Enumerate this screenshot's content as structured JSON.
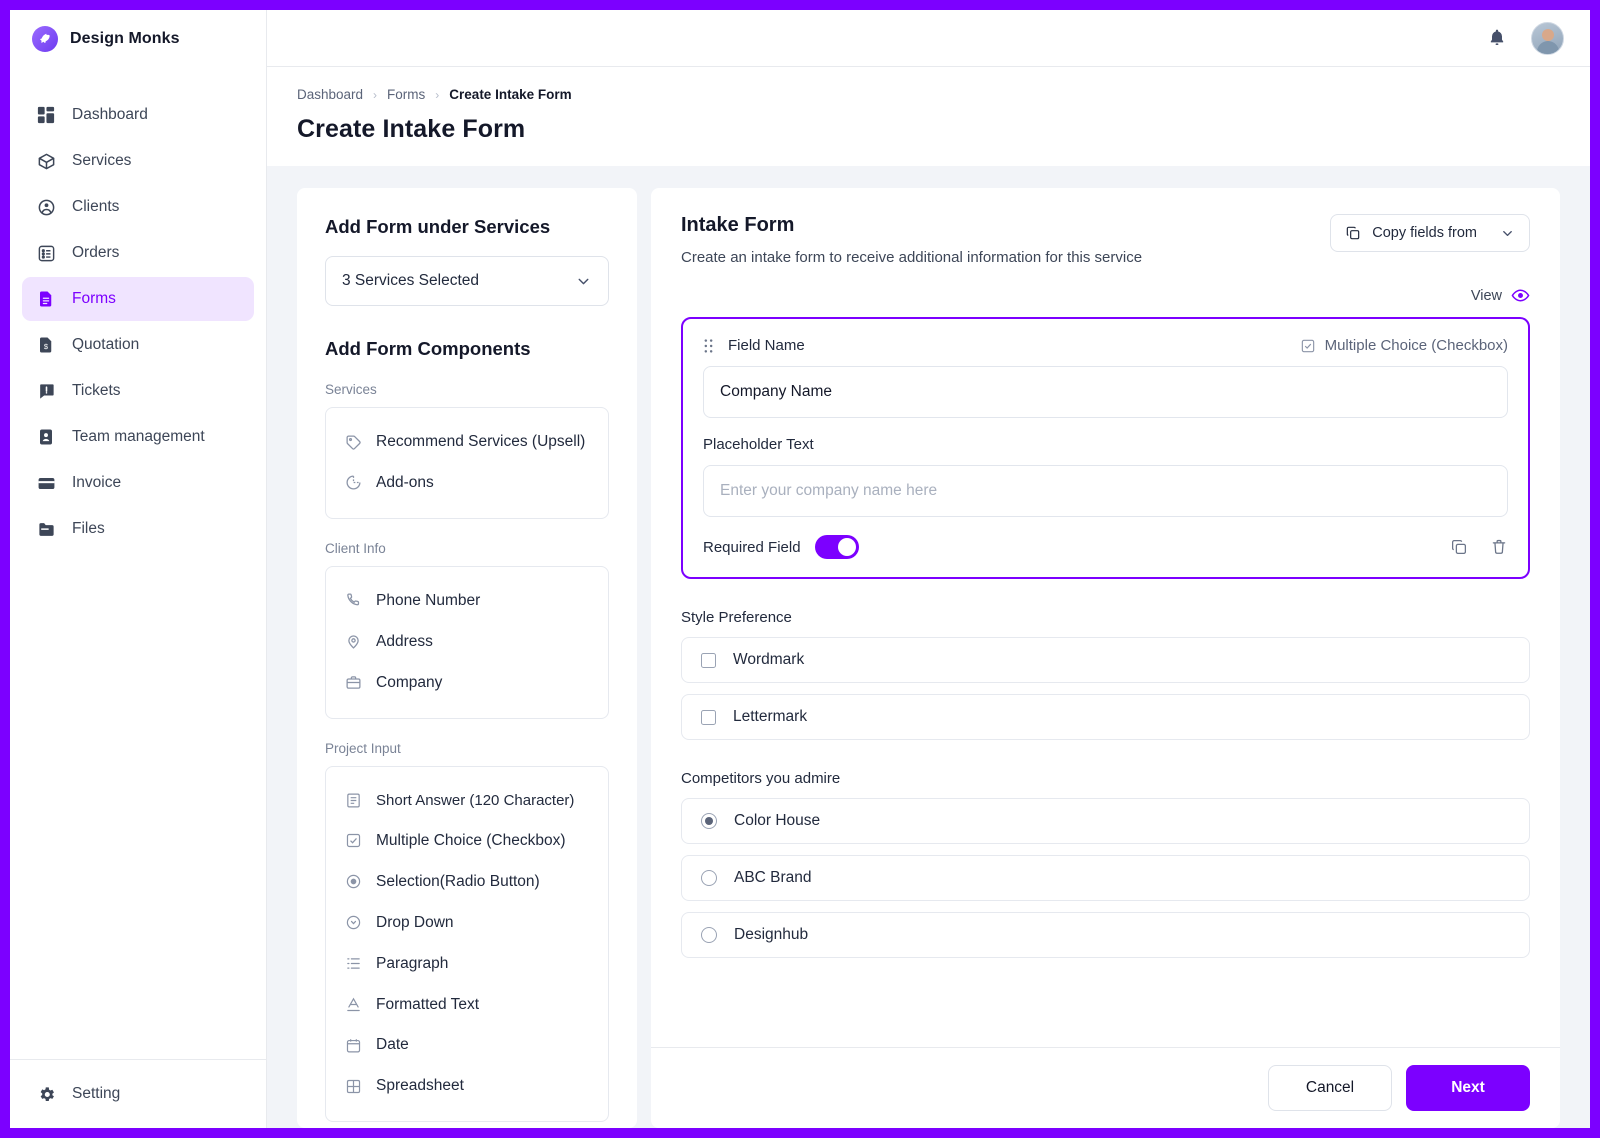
{
  "brand": {
    "name": "Design Monks",
    "logo_icon": "rocket-logo-icon",
    "accent": "#7C00FF"
  },
  "topbar": {
    "bell_icon": "notification-bell-icon",
    "avatar_icon": "user-avatar"
  },
  "sidebar": {
    "items": [
      {
        "label": "Dashboard",
        "icon": "dashboard-grid-icon",
        "active": false
      },
      {
        "label": "Services",
        "icon": "box-icon",
        "active": false
      },
      {
        "label": "Clients",
        "icon": "clients-circle-icon",
        "active": false
      },
      {
        "label": "Orders",
        "icon": "list-icon",
        "active": false
      },
      {
        "label": "Forms",
        "icon": "document-icon",
        "active": true
      },
      {
        "label": "Quotation",
        "icon": "quote-document-icon",
        "active": false
      },
      {
        "label": "Tickets",
        "icon": "ticket-alert-icon",
        "active": false
      },
      {
        "label": "Team management",
        "icon": "user-card-icon",
        "active": false
      },
      {
        "label": "Invoice",
        "icon": "invoice-card-icon",
        "active": false
      },
      {
        "label": "Files",
        "icon": "folder-icon",
        "active": false
      }
    ],
    "bottom": {
      "label": "Setting",
      "icon": "gear-icon"
    }
  },
  "breadcrumb": {
    "items": [
      "Dashboard",
      "Forms",
      "Create Intake Form"
    ],
    "separator": "›"
  },
  "page": {
    "title": "Create Intake Form"
  },
  "left_panel": {
    "heading": "Add Form under Services",
    "service_select": {
      "value": "3 Services Selected",
      "chevron_icon": "chevron-down-icon"
    },
    "components_heading": "Add Form Components",
    "groups": [
      {
        "label": "Services",
        "items": [
          {
            "label": "Recommend Services (Upsell)",
            "icon": "tag-icon"
          },
          {
            "label": "Add-ons",
            "icon": "pie-chart-icon"
          }
        ]
      },
      {
        "label": "Client Info",
        "items": [
          {
            "label": "Phone Number",
            "icon": "phone-icon"
          },
          {
            "label": "Address",
            "icon": "location-pin-icon"
          },
          {
            "label": "Company",
            "icon": "briefcase-icon"
          }
        ]
      },
      {
        "label": "Project Input",
        "items": [
          {
            "label": "Short Answer (120 Character)",
            "icon": "short-answer-icon"
          },
          {
            "label": "Multiple Choice (Checkbox)",
            "icon": "checkbox-icon"
          },
          {
            "label": "Selection(Radio Button)",
            "icon": "radio-icon"
          },
          {
            "label": "Drop Down",
            "icon": "drop-down-icon"
          },
          {
            "label": "Paragraph",
            "icon": "paragraph-icon"
          },
          {
            "label": "Formatted Text",
            "icon": "formatted-text-icon"
          },
          {
            "label": "Date",
            "icon": "calendar-icon"
          },
          {
            "label": "Spreadsheet",
            "icon": "spreadsheet-icon"
          }
        ]
      }
    ]
  },
  "right_panel": {
    "title": "Intake Form",
    "subtitle": "Create an intake form to receive additional information for this service",
    "copy_fields": {
      "label": "Copy fields from",
      "icon": "copy-icon",
      "chevron_icon": "chevron-down-icon"
    },
    "view": {
      "label": "View",
      "icon": "eye-icon"
    },
    "field_card": {
      "drag_icon": "drag-handle-icon",
      "field_name_label": "Field Name",
      "type_label": "Multiple Choice (Checkbox)",
      "type_icon": "checkbox-icon",
      "field_name_value": "Company Name",
      "field_name_placeholder": "Field name",
      "placeholder_label": "Placeholder Text",
      "placeholder_value": "",
      "placeholder_placeholder": "Enter your company name here",
      "required_label": "Required Field",
      "required_on": true,
      "duplicate_icon": "duplicate-icon",
      "delete_icon": "trash-icon"
    },
    "sections": [
      {
        "title": "Style Preference",
        "control": "checkbox",
        "options": [
          {
            "label": "Wordmark",
            "selected": false
          },
          {
            "label": "Lettermark",
            "selected": false
          }
        ]
      },
      {
        "title": "Competitors you admire",
        "control": "radio",
        "options": [
          {
            "label": "Color House",
            "selected": true
          },
          {
            "label": "ABC Brand",
            "selected": false
          },
          {
            "label": "Designhub",
            "selected": false
          }
        ]
      }
    ],
    "footer": {
      "cancel_label": "Cancel",
      "next_label": "Next"
    }
  }
}
